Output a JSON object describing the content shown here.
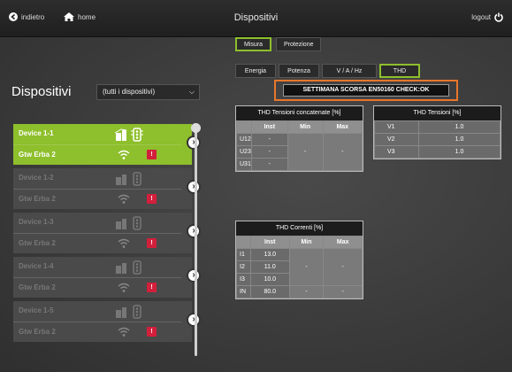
{
  "header": {
    "back_label": "indietro",
    "home_label": "home",
    "title": "Dispositivi",
    "logout_label": "logout"
  },
  "tabs_primary": [
    {
      "label": "Misura",
      "active": true
    },
    {
      "label": "Protezione",
      "active": false
    }
  ],
  "tabs_secondary": [
    {
      "label": "Energia",
      "active": false
    },
    {
      "label": "Potenza",
      "active": false
    },
    {
      "label": "V / A / Hz",
      "active": false
    },
    {
      "label": "THD",
      "active": true
    }
  ],
  "check_banner": "SETTIMANA SCORSA EN50160 CHECK:OK",
  "page_heading": "Dispositivi",
  "device_filter": {
    "selected": "(tutti i dispositivi)"
  },
  "devices": [
    {
      "name": "Device 1-1",
      "gateway": "Gtw Erba 2",
      "active": true,
      "alarm": "!"
    },
    {
      "name": "Device 1-2",
      "gateway": "Gtw Erba 2",
      "active": false,
      "alarm": "!"
    },
    {
      "name": "Device 1-3",
      "gateway": "Gtw Erba 2",
      "active": false,
      "alarm": "!"
    },
    {
      "name": "Device 1-4",
      "gateway": "Gtw Erba 2",
      "active": false,
      "alarm": "!"
    },
    {
      "name": "Device 1-5",
      "gateway": "Gtw Erba 2",
      "active": false,
      "alarm": "!"
    }
  ],
  "thd_concatenate": {
    "title": "THD Tensioni concatenate [%]",
    "headers": [
      "",
      "Inst",
      "Min",
      "Max"
    ],
    "rows": [
      {
        "label": "U12",
        "inst": "-"
      },
      {
        "label": "U23",
        "inst": "-"
      },
      {
        "label": "U31",
        "inst": "-"
      }
    ],
    "min": "-",
    "max": "-"
  },
  "thd_tensioni": {
    "title": "THD Tensioni [%]",
    "rows": [
      {
        "label": "V1",
        "value": "1.0"
      },
      {
        "label": "V2",
        "value": "1.0"
      },
      {
        "label": "V3",
        "value": "1.0"
      }
    ]
  },
  "thd_correnti": {
    "title": "THD Correnti [%]",
    "headers": [
      "",
      "Inst",
      "Min",
      "Max"
    ],
    "rows": [
      {
        "label": "I1",
        "inst": "13.0"
      },
      {
        "label": "I2",
        "inst": "11.0"
      },
      {
        "label": "I3",
        "inst": "10.0"
      }
    ],
    "min": "-",
    "max": "-",
    "neutral": {
      "label": "IN",
      "inst": "80.0",
      "min": "-",
      "max": "-"
    }
  },
  "colors": {
    "accent": "#8ebf2c",
    "highlight": "#e8762b",
    "alarm": "#d21f3c"
  }
}
